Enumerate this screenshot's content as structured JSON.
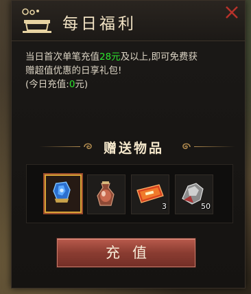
{
  "dialog": {
    "title": "每日福利",
    "close_icon": "close-x-icon"
  },
  "description": {
    "line1_prefix": "当日首次单笔充值",
    "line1_amount": "28元",
    "line1_suffix": "及以上,即可免费获",
    "line2": "赠超值优惠的日享礼包!",
    "line3_prefix": "(今日充值:",
    "line3_value": "0",
    "line3_suffix": "元)"
  },
  "rewards": {
    "section_title": "赠送物品",
    "items": [
      {
        "icon": "blue-gem-icon",
        "quantity": "",
        "selected": true
      },
      {
        "icon": "potion-pouch-icon",
        "quantity": "",
        "selected": false
      },
      {
        "icon": "red-ticket-icon",
        "quantity": "3",
        "selected": false
      },
      {
        "icon": "silver-ore-icon",
        "quantity": "50",
        "selected": false
      }
    ]
  },
  "button": {
    "recharge_label": "充值"
  },
  "colors": {
    "highlight_green": "#2ee62e",
    "title_text": "#f2e3c4",
    "button_red": "#8a3c31"
  }
}
